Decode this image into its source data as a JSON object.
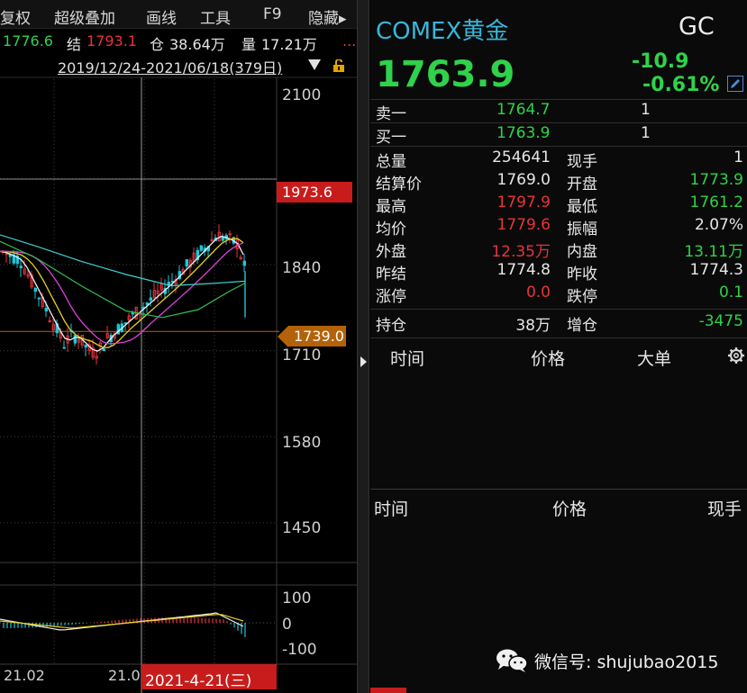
{
  "toolbar": {
    "items": [
      "复权",
      "超级叠加",
      "画线",
      "工具",
      "F9",
      "隐藏▸"
    ]
  },
  "infoline": {
    "price": "1776.6",
    "settle_label": "结",
    "settle_value": "1793.1",
    "oi_label": "仓",
    "oi_value": "38.64万",
    "vol_label": "量",
    "vol_value": "17.21万",
    "more": "..."
  },
  "date_range": "2019/12/24-2021/06/18(379日)",
  "chart": {
    "y_labels": [
      "2100",
      "1840",
      "1710",
      "1580",
      "1450"
    ],
    "price_tag_high": "1973.6",
    "cross_value": "1739.0",
    "macd_labels": [
      "100",
      "0",
      "-100"
    ],
    "x_labels": [
      "21.02",
      "21.0"
    ],
    "cursor_date": "2021-4-21(三)",
    "colors": {
      "up": "#e8333a",
      "down": "#1fc6d8",
      "ma5": "#f0f0f0",
      "ma10": "#e8d020",
      "ma20": "#e040e0",
      "ma60": "#30c050",
      "ma120": "#40d0d0"
    }
  },
  "chart_data": {
    "type": "candlestick",
    "title": "",
    "ylim": [
      1390,
      2120
    ],
    "cursor_value": 1739.0,
    "high_marker": 1973.6,
    "ma_lines": {
      "white_ma": [
        {
          "x": "21.01",
          "y": 1845
        },
        {
          "x": "21.02",
          "y": 1800
        },
        {
          "x": "21.03",
          "y": 1720
        },
        {
          "x": "21.04",
          "y": 1745
        },
        {
          "x": "21.05",
          "y": 1860
        },
        {
          "x": "21.06",
          "y": 1830
        }
      ]
    },
    "macd_ylim": [
      -100,
      100
    ]
  },
  "quote": {
    "name": "COMEX黄金",
    "code": "GC",
    "last": "1763.9",
    "change": "-10.9",
    "change_pct": "-0.61%",
    "ask_label": "卖一",
    "ask_price": "1764.7",
    "ask_vol": "1",
    "bid_label": "买一",
    "bid_price": "1763.9",
    "bid_vol": "1",
    "stats": [
      {
        "l1": "总量",
        "v1": "254641",
        "c1": "white",
        "l2": "现手",
        "v2": "1",
        "c2": "white"
      },
      {
        "l1": "结算价",
        "v1": "1769.0",
        "c1": "white",
        "l2": "开盘",
        "v2": "1773.9",
        "c2": "green"
      },
      {
        "l1": "最高",
        "v1": "1797.9",
        "c1": "red",
        "l2": "最低",
        "v2": "1761.2",
        "c2": "green"
      },
      {
        "l1": "均价",
        "v1": "1779.6",
        "c1": "red",
        "l2": "振幅",
        "v2": "2.07%",
        "c2": "white"
      },
      {
        "l1": "外盘",
        "v1": "12.35万",
        "c1": "red",
        "l2": "内盘",
        "v2": "13.11万",
        "c2": "green"
      },
      {
        "l1": "昨结",
        "v1": "1774.8",
        "c1": "white",
        "l2": "昨收",
        "v2": "1774.3",
        "c2": "white"
      },
      {
        "l1": "涨停",
        "v1": "0.0",
        "c1": "red",
        "l2": "跌停",
        "v2": "0.1",
        "c2": "green"
      }
    ],
    "oi_label": "持仓",
    "oi_value": "38万",
    "oi_chg_label": "增仓",
    "oi_chg_value": "-3475"
  },
  "big_trades": {
    "col_time": "时间",
    "col_price": "价格",
    "col_big": "大单"
  },
  "ticks": {
    "col_time": "时间",
    "col_price": "价格",
    "col_vol": "现手"
  },
  "watermark": "微信号: shujubao2015"
}
